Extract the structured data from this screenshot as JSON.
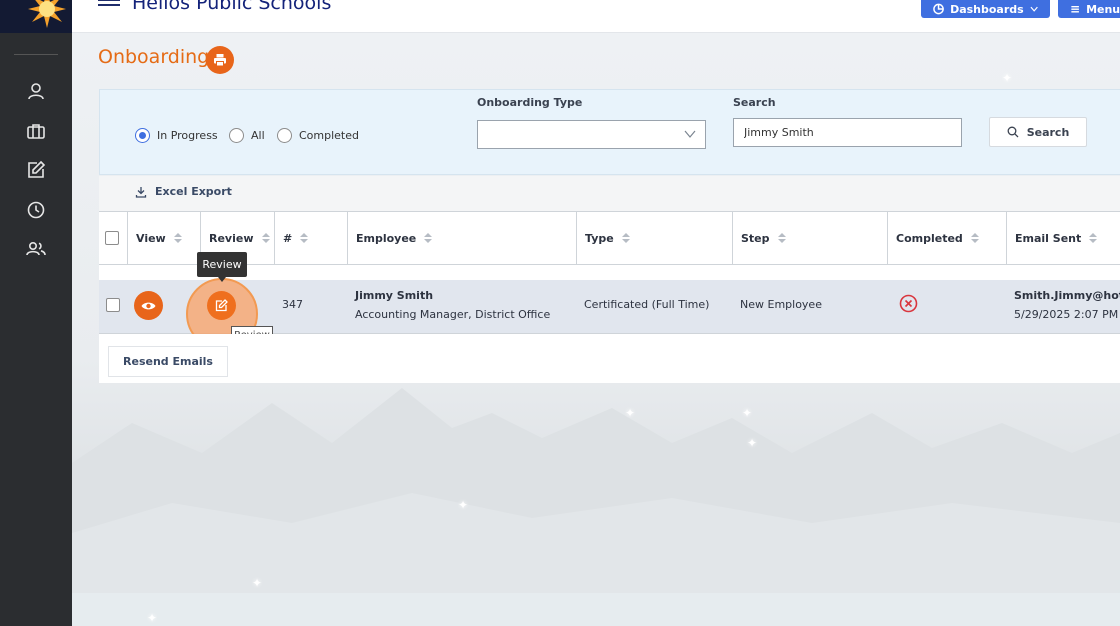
{
  "header": {
    "title": "Helios Public Schools",
    "dashboards_label": "Dashboards",
    "menu_label": "Menu"
  },
  "page": {
    "title": "Onboarding"
  },
  "sidebar": {
    "items": [
      {
        "icon": "user-icon"
      },
      {
        "icon": "briefcase-icon"
      },
      {
        "icon": "edit-icon"
      },
      {
        "icon": "clock-icon"
      },
      {
        "icon": "users-icon"
      }
    ]
  },
  "filters": {
    "status_options": [
      {
        "label": "In Progress",
        "checked": true
      },
      {
        "label": "All",
        "checked": false
      },
      {
        "label": "Completed",
        "checked": false
      }
    ],
    "onboarding_type_label": "Onboarding Type",
    "onboarding_type_value": "",
    "search_label": "Search",
    "search_value": "Jimmy Smith",
    "search_button": "Search"
  },
  "toolbar": {
    "export_label": "Excel Export"
  },
  "table": {
    "columns": [
      "View",
      "Review",
      "#",
      "Employee",
      "Type",
      "Step",
      "Completed",
      "Email Sent"
    ],
    "rows": [
      {
        "id": "347",
        "employee_name": "Jimmy Smith",
        "employee_title": "Accounting Manager, District Office",
        "type": "Certificated (Full Time)",
        "step": "New Employee",
        "completed": false,
        "email": "Smith.Jimmy@hotr",
        "email_date": "5/29/2025 2:07 PM"
      }
    ]
  },
  "tooltips": {
    "review_dark": "Review",
    "review_light": "Review"
  },
  "actions": {
    "resend_label": "Resend Emails"
  },
  "colors": {
    "accent_orange": "#e8651a",
    "header_blue": "#3f6fe0",
    "title_navy": "#14237a",
    "sidebar_dark": "#2b2d30",
    "danger_red": "#d9363e"
  }
}
